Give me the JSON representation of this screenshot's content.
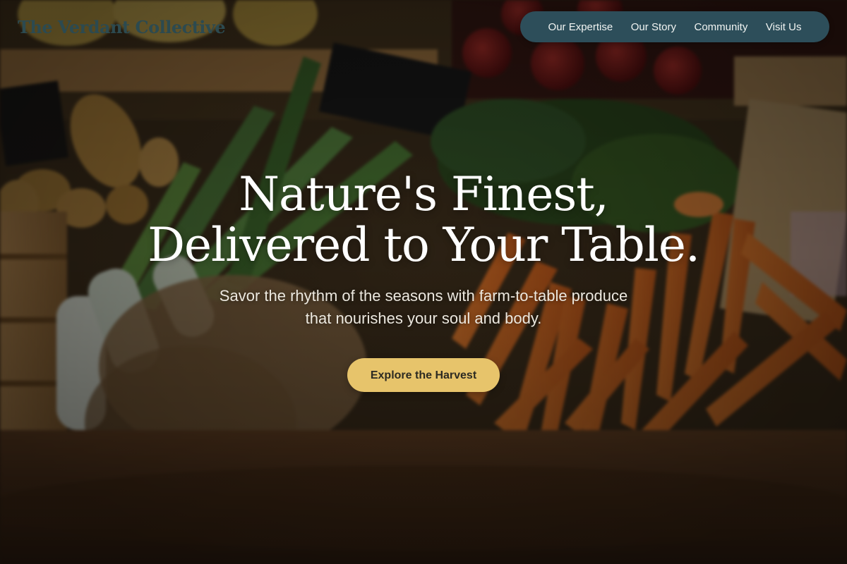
{
  "brand": {
    "name": "The Verdant Collective"
  },
  "nav": {
    "items": [
      {
        "label": "Our Expertise"
      },
      {
        "label": "Our Story"
      },
      {
        "label": "Community"
      },
      {
        "label": "Visit Us"
      }
    ]
  },
  "hero": {
    "headline_line1": "Nature's Finest,",
    "headline_line2": "Delivered to Your Table.",
    "subtitle_line1": "Savor the rhythm of the seasons with farm-to-table produce",
    "subtitle_line2": "that nourishes your soul and body.",
    "cta_label": "Explore the Harvest"
  },
  "colors": {
    "nav_background": "#2d4e5a",
    "cta_background": "#e7c46b",
    "brand_text": "#2c4a50"
  }
}
